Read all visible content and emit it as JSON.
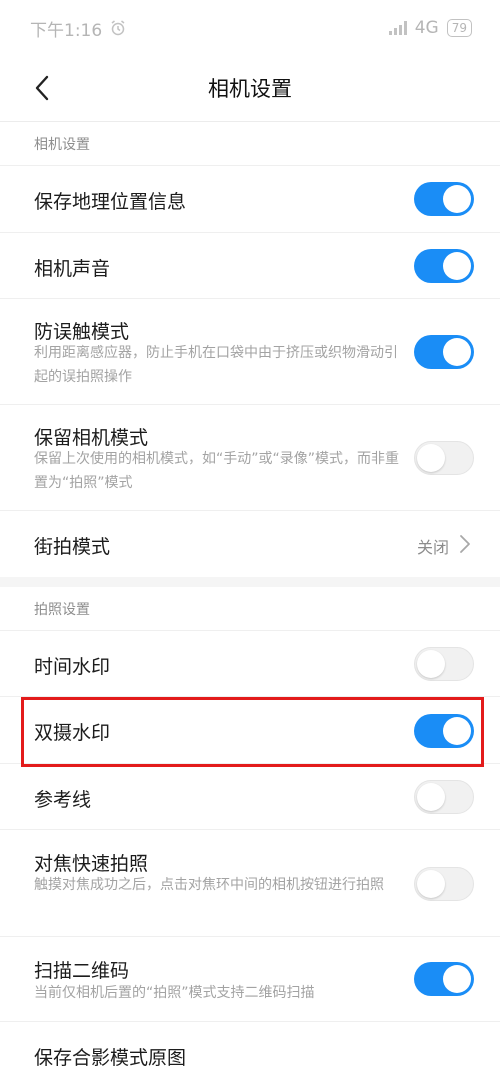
{
  "status_bar": {
    "time": "下午1:16",
    "network": "4G",
    "battery": "79"
  },
  "header": {
    "title": "相机设置"
  },
  "sections": [
    {
      "header": "相机设置",
      "items": [
        {
          "title": "保存地理位置信息",
          "toggle": "on"
        },
        {
          "title": "相机声音",
          "toggle": "on"
        },
        {
          "title": "防误触模式",
          "description": "利用距离感应器，防止手机在口袋中由于挤压或织物滑动引起的误拍照操作",
          "toggle": "on"
        },
        {
          "title": "保留相机模式",
          "description": "保留上次使用的相机模式，如“手动”或“录像”模式，而非重置为“拍照”模式",
          "toggle": "off"
        },
        {
          "title": "街拍模式",
          "value": "关闭"
        }
      ]
    },
    {
      "header": "拍照设置",
      "items": [
        {
          "title": "时间水印",
          "toggle": "off"
        },
        {
          "title": "双摄水印",
          "toggle": "on",
          "highlighted": true
        },
        {
          "title": "参考线",
          "toggle": "off"
        },
        {
          "title": "对焦快速拍照",
          "description": "触摸对焦成功之后，点击对焦环中间的相机按钮进行拍照",
          "toggle": "off"
        },
        {
          "title": "扫描二维码",
          "description": "当前仅相机后置的“拍照”模式支持二维码扫描",
          "toggle": "on"
        },
        {
          "title": "保存合影模式原图"
        }
      ]
    }
  ],
  "colors": {
    "accent": "#1a8df6",
    "highlight_border": "#e31b1b",
    "toggle_off": "#f1f1f1"
  },
  "icons": {
    "back": "chevron-left-icon",
    "more": "chevron-right-icon",
    "alarm": "alarm-clock-icon"
  }
}
